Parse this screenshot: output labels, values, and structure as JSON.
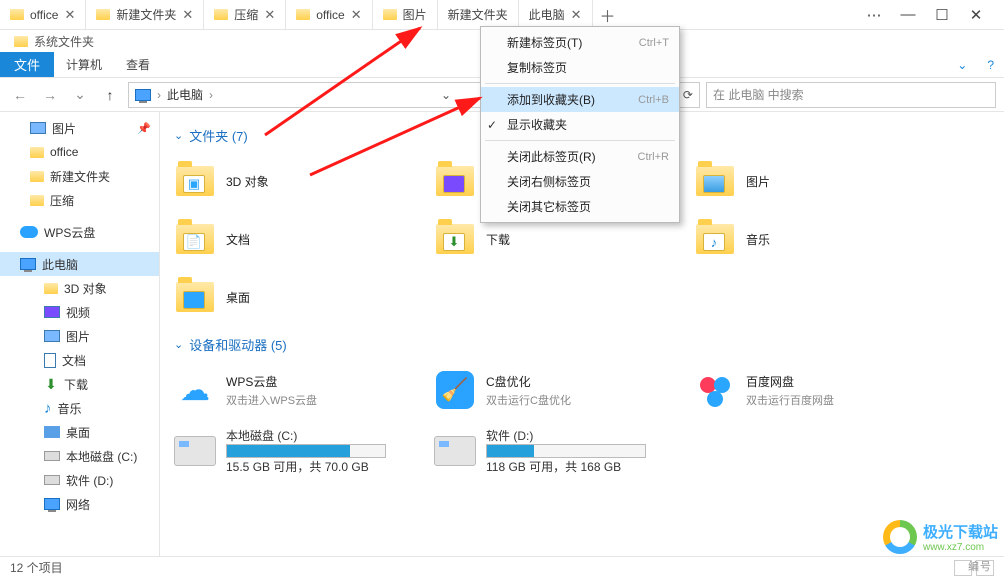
{
  "tabs": [
    "office",
    "新建文件夹",
    "压缩",
    "office",
    "图片",
    "新建文件夹",
    "此电脑"
  ],
  "crumb": "系统文件夹",
  "menus": {
    "file": "文件",
    "computer": "计算机",
    "view": "查看"
  },
  "address": {
    "location": "此电脑"
  },
  "search": {
    "placeholder": "在 此电脑 中搜索"
  },
  "sidebar": {
    "quick": [
      {
        "label": "图片"
      },
      {
        "label": "office"
      },
      {
        "label": "新建文件夹"
      },
      {
        "label": "压缩"
      }
    ],
    "wps": "WPS云盘",
    "thispc": "此电脑",
    "pcchildren": [
      "3D 对象",
      "视频",
      "图片",
      "文档",
      "下载",
      "音乐",
      "桌面",
      "本地磁盘 (C:)",
      "软件 (D:)",
      "网络"
    ]
  },
  "sections": {
    "folders": {
      "title": "文件夹 (7)",
      "items": [
        "3D 对象",
        "文档",
        "桌面",
        "视频",
        "下载",
        "图片",
        "音乐"
      ]
    },
    "devices": {
      "title": "设备和驱动器 (5)",
      "clouds": [
        {
          "title": "WPS云盘",
          "sub": "双击进入WPS云盘"
        },
        {
          "title": "C盘优化",
          "sub": "双击运行C盘优化"
        },
        {
          "title": "百度网盘",
          "sub": "双击运行百度网盘"
        }
      ],
      "drives": [
        {
          "title": "本地磁盘 (C:)",
          "sub": "15.5 GB 可用，共 70.0 GB",
          "fill": 78
        },
        {
          "title": "软件 (D:)",
          "sub": "118 GB 可用，共 168 GB",
          "fill": 30
        }
      ]
    }
  },
  "ctx": {
    "newtab": "新建标签页(T)",
    "newtab_sc": "Ctrl+T",
    "dup": "复制标签页",
    "addfav": "添加到收藏夹(B)",
    "addfav_sc": "Ctrl+B",
    "showfav": "显示收藏夹",
    "closethis": "关闭此标签页(R)",
    "closethis_sc": "Ctrl+R",
    "closeright": "关闭右侧标签页",
    "closeother": "关闭其它标签页"
  },
  "status": {
    "count": "12 个项目"
  },
  "watermark": {
    "name": "极光下载站",
    "url": "www.xz7.com",
    "stamp": "编号"
  }
}
